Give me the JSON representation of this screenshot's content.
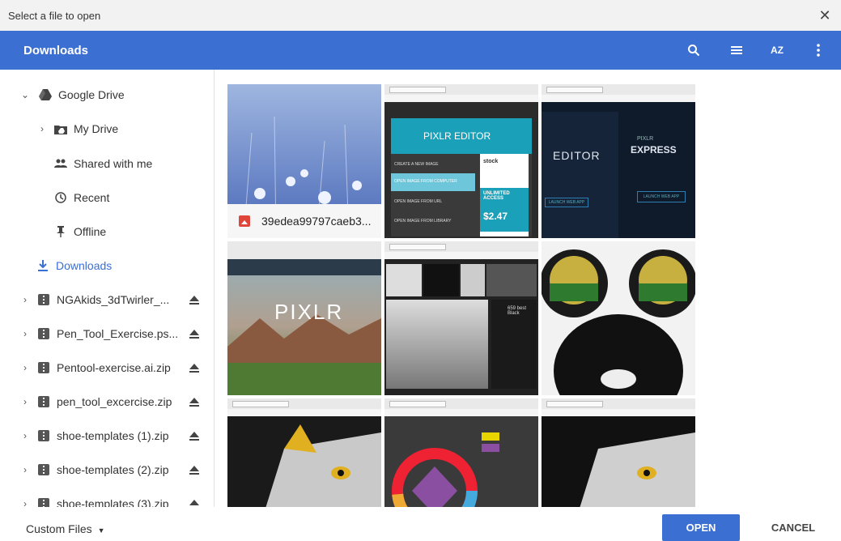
{
  "window": {
    "title": "Select a file to open",
    "close_glyph": "✕"
  },
  "header": {
    "title": "Downloads",
    "icons": [
      "search-icon",
      "list-view-icon",
      "sort-az-icon",
      "more-vert-icon"
    ],
    "sort_label": "AZ",
    "color": "#3b6fd1"
  },
  "sidebar": {
    "google_drive": "Google Drive",
    "my_drive": "My Drive",
    "shared": "Shared with me",
    "recent": "Recent",
    "offline": "Offline",
    "downloads": "Downloads",
    "zips": [
      "NGAkids_3dTwirler_...",
      "Pen_Tool_Exercise.ps...",
      "Pentool-exercise.ai.zip",
      "pen_tool_excercise.zip",
      "shoe-templates (1).zip",
      "shoe-templates (2).zip",
      "shoe-templates (3).zip"
    ]
  },
  "grid": {
    "caption": "39edea99797caeb3...",
    "pixlr_editor_title": "PIXLR EDITOR",
    "pixlr_editor_word": "EDITOR",
    "pixlr_express_word": "EXPRESS",
    "pixlr_small": "PIXLR",
    "pixlr_big": "PIXLR",
    "create_new": "CREATE A NEW IMAGE",
    "open_computer": "OPEN IMAGE FROM COMPUTER",
    "open_url": "OPEN IMAGE FROM URL",
    "open_library": "OPEN IMAGE FROM LIBRARY",
    "stock_word": "stock",
    "unlimited": "UNLIMITED ACCESS",
    "price": "$2.47",
    "launch_web": "LAUNCH WEB APP",
    "launch_web2": "LAUNCH WEB APP",
    "count_label": "659 best Black"
  },
  "footer": {
    "custom_files": "Custom Files",
    "open": "OPEN",
    "cancel": "CANCEL"
  }
}
